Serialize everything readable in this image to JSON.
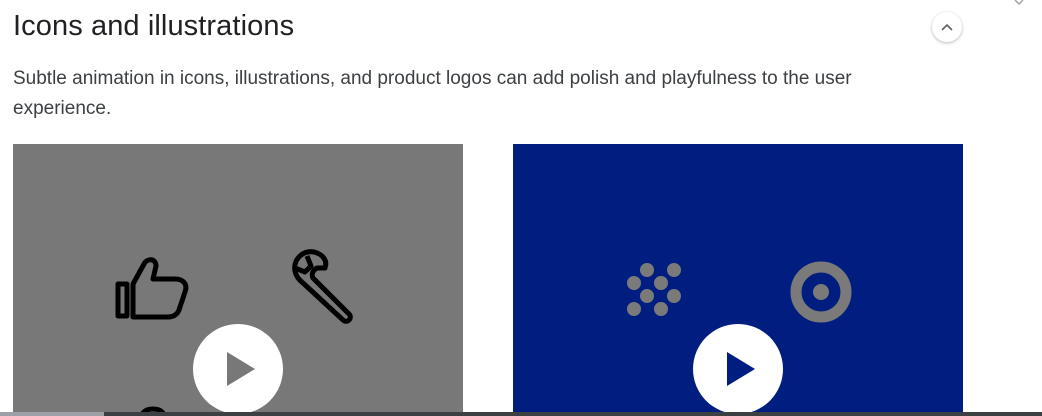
{
  "section": {
    "title": "Icons and illustrations",
    "description": "Subtle animation in icons, illustrations, and product logos can add polish and playfulness to the user experience."
  },
  "collapse_button": {
    "icon": "chevron-up-icon",
    "aria_label": "Collapse section"
  },
  "cards": [
    {
      "background": "#787878",
      "icons": [
        "thumbs-up-icon",
        "wrench-icon"
      ],
      "icon_color": "#000000",
      "play_icon": "play-icon",
      "play_aria": "Play video"
    },
    {
      "background": "#001e80",
      "icons": [
        "dot-cluster-icon",
        "target-ring-icon"
      ],
      "icon_color": "#7a7a7a",
      "play_icon": "play-icon",
      "play_aria": "Play video"
    }
  ],
  "colors": {
    "title": "#202124",
    "body_text": "#3c4043",
    "play_glyph_left": "#787878",
    "play_glyph_right": "#001e80"
  },
  "scroll_progress": 0.1
}
